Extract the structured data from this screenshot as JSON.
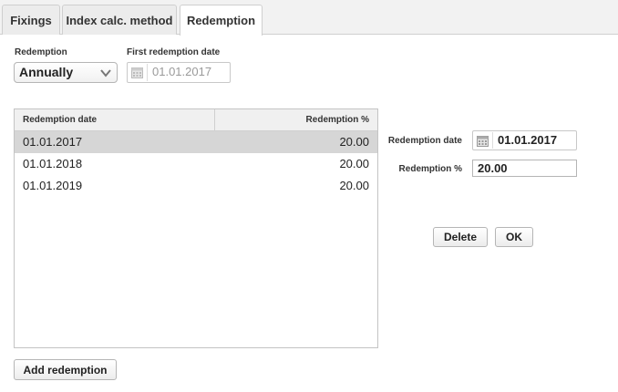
{
  "tabs": [
    {
      "label": "Fixings"
    },
    {
      "label": "Index calc. method"
    },
    {
      "label": "Redemption"
    }
  ],
  "form": {
    "redemption_label": "Redemption",
    "redemption_value": "Annually",
    "first_date_label": "First redemption date",
    "first_date_value": "01.01.2017"
  },
  "table": {
    "headers": {
      "date": "Redemption date",
      "percent": "Redemption %"
    },
    "rows": [
      {
        "date": "01.01.2017",
        "percent": "20.00"
      },
      {
        "date": "01.01.2018",
        "percent": "20.00"
      },
      {
        "date": "01.01.2019",
        "percent": "20.00"
      }
    ]
  },
  "detail": {
    "date_label": "Redemption date",
    "date_value": "01.01.2017",
    "percent_label": "Redemption %",
    "percent_value": "20.00",
    "delete_label": "Delete",
    "ok_label": "OK"
  },
  "add_button_label": "Add redemption",
  "colors": {
    "selected_row": "#d6d6d6",
    "header_bg": "#f0f0f0",
    "border": "#c4c4c4"
  },
  "icons": {
    "calendar": "calendar-icon",
    "dropdown": "chevron-down-icon"
  }
}
